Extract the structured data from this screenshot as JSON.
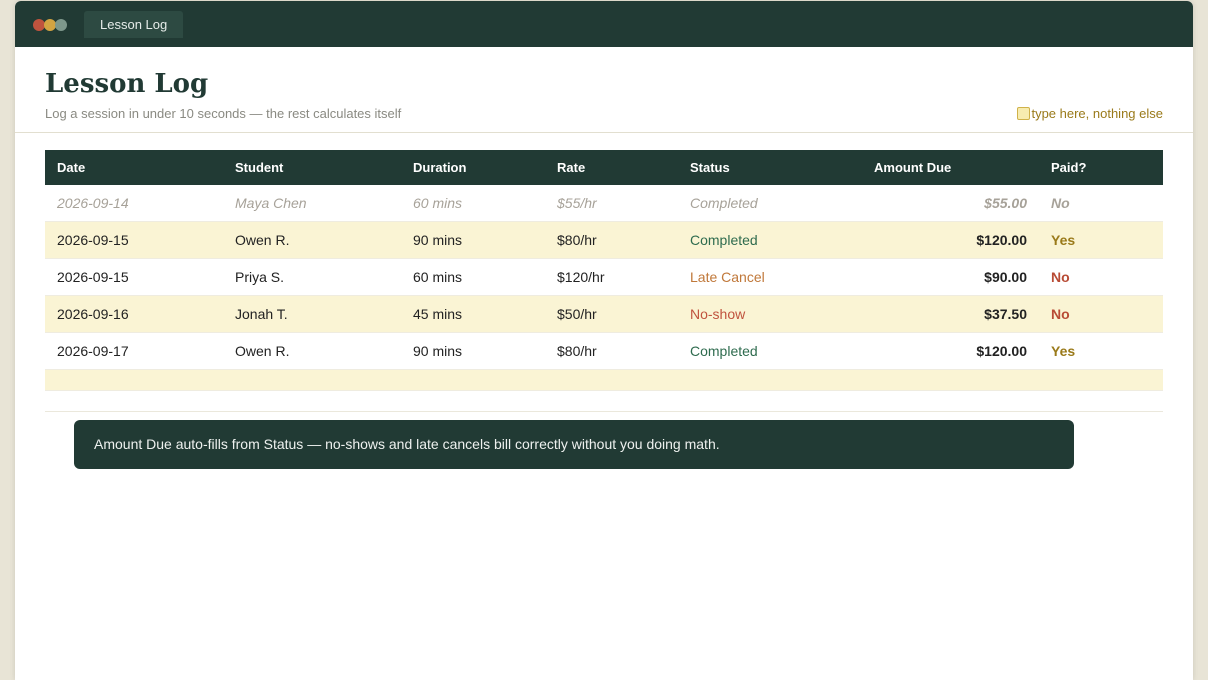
{
  "window": {
    "tab_label": "Lesson Log"
  },
  "header": {
    "title": "Lesson Log",
    "subtitle": "Log a session in under 10 seconds — the rest calculates itself",
    "hint": "type here, nothing else"
  },
  "table": {
    "columns": [
      "Date",
      "Student",
      "Duration",
      "Rate",
      "Status",
      "Amount Due",
      "Paid?"
    ],
    "rows": [
      [
        "2026-09-14",
        "Maya Chen",
        "60 mins",
        "$55/hr",
        "Completed",
        "$55.00",
        "No"
      ],
      [
        "2026-09-15",
        "Owen R.",
        "90 mins",
        "$80/hr",
        "Completed",
        "$120.00",
        "Yes"
      ],
      [
        "2026-09-15",
        "Priya S.",
        "60 mins",
        "$120/hr",
        "Late Cancel",
        "$90.00",
        "No"
      ],
      [
        "2026-09-16",
        "Jonah T.",
        "45 mins",
        "$50/hr",
        "No-show",
        "$37.50",
        "No"
      ],
      [
        "2026-09-17",
        "Owen R.",
        "90 mins",
        "$80/hr",
        "Completed",
        "$120.00",
        "Yes"
      ]
    ]
  },
  "callout": {
    "text": "Amount Due auto-fills from Status — no-shows and late cancels bill correctly without you doing math."
  },
  "colors": {
    "header_dark": "#213a34",
    "row_highlight": "#faf4d4",
    "completed": "#2e6b4e",
    "late_cancel": "#c0783a",
    "no_show": "#c0533e",
    "paid_yes": "#9a7a1a",
    "paid_no": "#b84b35"
  }
}
